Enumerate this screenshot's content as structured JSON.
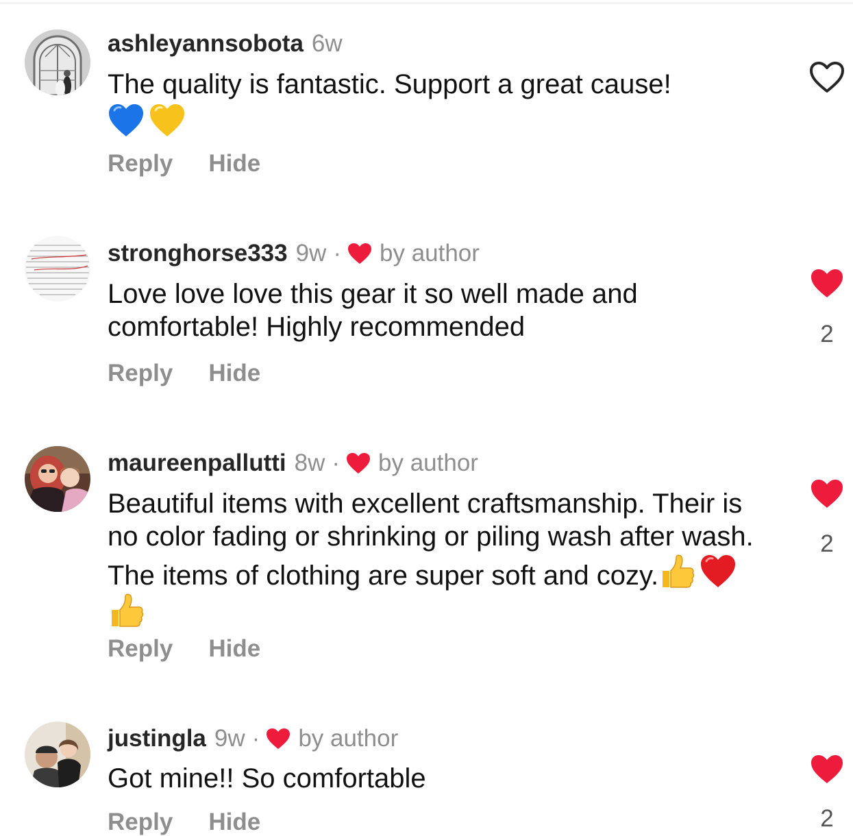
{
  "colors": {
    "text": "#111111",
    "muted": "#8e8e8e",
    "like_red": "#ed1c3c"
  },
  "comments": [
    {
      "username": "ashleyannsobota",
      "time": "6w",
      "author_liked": false,
      "text": "The quality is fantastic. Support a great cause!",
      "emojis": [
        "blue-heart",
        "yellow-heart"
      ],
      "reply_label": "Reply",
      "hide_label": "Hide",
      "liked": false,
      "like_count": ""
    },
    {
      "username": "stronghorse333",
      "time": "9w",
      "separator": "·",
      "author_liked": true,
      "by_author": "by author",
      "text": "Love love love this gear it so well made and comfortable! Highly recommended",
      "reply_label": "Reply",
      "hide_label": "Hide",
      "liked": true,
      "like_count": "2"
    },
    {
      "username": "maureenpallutti",
      "time": "8w",
      "separator": "·",
      "author_liked": true,
      "by_author": "by author",
      "text": "Beautiful items with excellent craftsmanship. Their is no color fading or shrinking or piling wash after wash. The items of clothing are super soft and cozy.",
      "emojis": [
        "thumbs-up",
        "red-heart",
        "thumbs-up"
      ],
      "reply_label": "Reply",
      "hide_label": "Hide",
      "liked": true,
      "like_count": "2"
    },
    {
      "username": "justingla",
      "time": "9w",
      "separator": "·",
      "author_liked": true,
      "by_author": "by author",
      "text": "Got mine!! So comfortable",
      "reply_label": "Reply",
      "hide_label": "Hide",
      "liked": true,
      "like_count": "2"
    }
  ]
}
